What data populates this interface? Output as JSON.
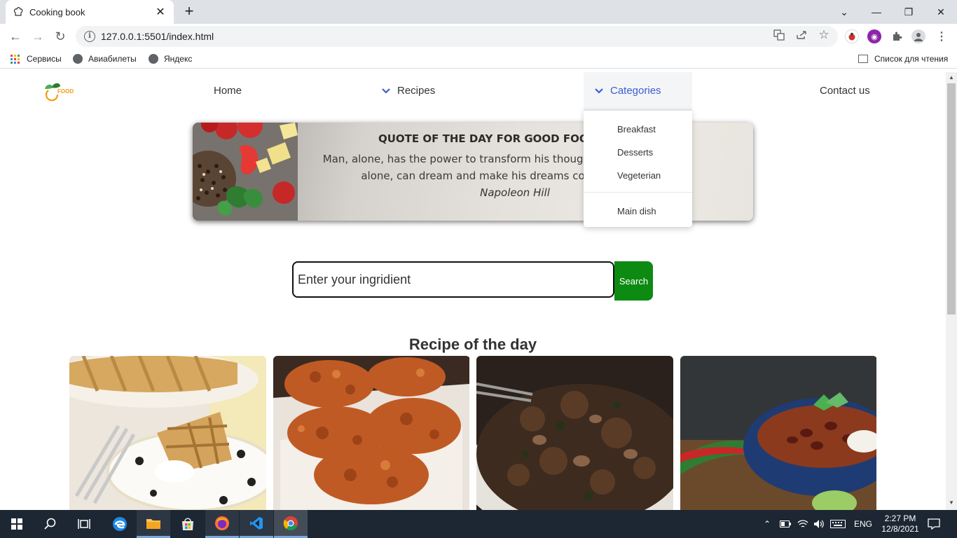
{
  "browser": {
    "tab_title": "Cooking book",
    "tab_close": "✕",
    "new_tab": "+",
    "url": "127.0.0.1:5501/index.html",
    "window_controls": {
      "minimize": "—",
      "restore": "❐",
      "close": "✕",
      "tab_list": "⌄"
    },
    "bookmarks": [
      "Сервисы",
      "Авиабилеты",
      "Яндекс"
    ],
    "reading_list": "Список для чтения"
  },
  "nav": {
    "logo_text": "FOOD",
    "home": "Home",
    "recipes": "Recipes",
    "categories": "Categories",
    "contact": "Contact us",
    "dropdown": [
      "Breakfast",
      "Desserts",
      "Vegeterian",
      "Main dish"
    ]
  },
  "quote": {
    "title": "QUOTE OF THE DAY FOR GOOD FOOD M",
    "line1": "Man, alone, has the power to transform his thoughts into",
    "line2": "alone, can dream and make his dreams co",
    "author": "Napoleon Hill"
  },
  "search": {
    "placeholder": "Enter your ingridient",
    "button": "Search"
  },
  "recipe_of_day": {
    "title": "Recipe of the day"
  },
  "taskbar": {
    "lang": "ENG",
    "time": "2:27 PM",
    "date": "12/8/2021"
  },
  "colors": {
    "accent_blue": "#3a5ed0",
    "search_green": "#0d8a12",
    "logo_orange": "#f39c12"
  },
  "icons": [
    "chef-hat-icon",
    "back-arrow-icon",
    "forward-arrow-icon",
    "reload-icon",
    "info-icon",
    "translate-icon",
    "share-icon",
    "star-icon",
    "extensions-icon",
    "profile-icon",
    "menu-icon",
    "windows-start-icon",
    "search-icon",
    "task-view-icon",
    "edge-icon",
    "file-explorer-icon",
    "store-icon",
    "firefox-icon",
    "vscode-icon",
    "chrome-icon"
  ]
}
